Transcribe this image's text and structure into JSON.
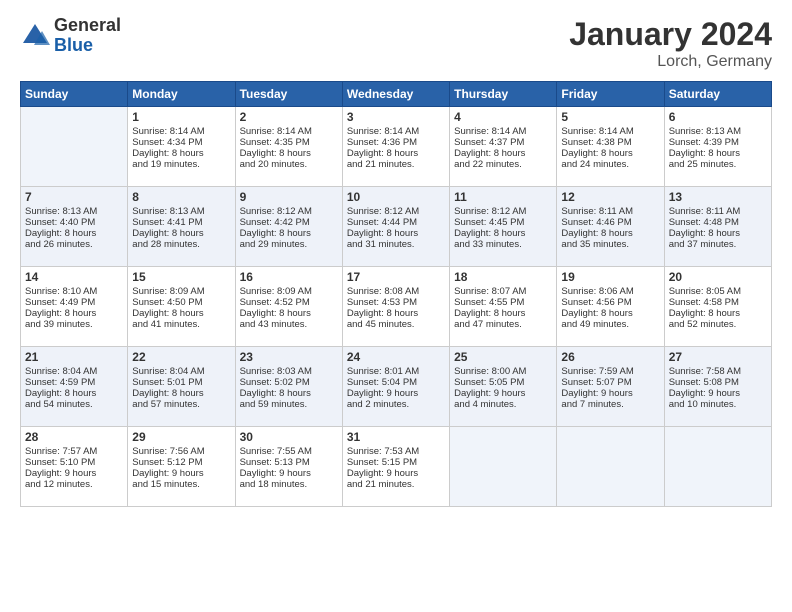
{
  "header": {
    "logo_general": "General",
    "logo_blue": "Blue",
    "title": "January 2024",
    "subtitle": "Lorch, Germany"
  },
  "days_of_week": [
    "Sunday",
    "Monday",
    "Tuesday",
    "Wednesday",
    "Thursday",
    "Friday",
    "Saturday"
  ],
  "weeks": [
    [
      {
        "day": "",
        "info": ""
      },
      {
        "day": "1",
        "info": "Sunrise: 8:14 AM\nSunset: 4:34 PM\nDaylight: 8 hours\nand 19 minutes."
      },
      {
        "day": "2",
        "info": "Sunrise: 8:14 AM\nSunset: 4:35 PM\nDaylight: 8 hours\nand 20 minutes."
      },
      {
        "day": "3",
        "info": "Sunrise: 8:14 AM\nSunset: 4:36 PM\nDaylight: 8 hours\nand 21 minutes."
      },
      {
        "day": "4",
        "info": "Sunrise: 8:14 AM\nSunset: 4:37 PM\nDaylight: 8 hours\nand 22 minutes."
      },
      {
        "day": "5",
        "info": "Sunrise: 8:14 AM\nSunset: 4:38 PM\nDaylight: 8 hours\nand 24 minutes."
      },
      {
        "day": "6",
        "info": "Sunrise: 8:13 AM\nSunset: 4:39 PM\nDaylight: 8 hours\nand 25 minutes."
      }
    ],
    [
      {
        "day": "7",
        "info": "Sunrise: 8:13 AM\nSunset: 4:40 PM\nDaylight: 8 hours\nand 26 minutes."
      },
      {
        "day": "8",
        "info": "Sunrise: 8:13 AM\nSunset: 4:41 PM\nDaylight: 8 hours\nand 28 minutes."
      },
      {
        "day": "9",
        "info": "Sunrise: 8:12 AM\nSunset: 4:42 PM\nDaylight: 8 hours\nand 29 minutes."
      },
      {
        "day": "10",
        "info": "Sunrise: 8:12 AM\nSunset: 4:44 PM\nDaylight: 8 hours\nand 31 minutes."
      },
      {
        "day": "11",
        "info": "Sunrise: 8:12 AM\nSunset: 4:45 PM\nDaylight: 8 hours\nand 33 minutes."
      },
      {
        "day": "12",
        "info": "Sunrise: 8:11 AM\nSunset: 4:46 PM\nDaylight: 8 hours\nand 35 minutes."
      },
      {
        "day": "13",
        "info": "Sunrise: 8:11 AM\nSunset: 4:48 PM\nDaylight: 8 hours\nand 37 minutes."
      }
    ],
    [
      {
        "day": "14",
        "info": "Sunrise: 8:10 AM\nSunset: 4:49 PM\nDaylight: 8 hours\nand 39 minutes."
      },
      {
        "day": "15",
        "info": "Sunrise: 8:09 AM\nSunset: 4:50 PM\nDaylight: 8 hours\nand 41 minutes."
      },
      {
        "day": "16",
        "info": "Sunrise: 8:09 AM\nSunset: 4:52 PM\nDaylight: 8 hours\nand 43 minutes."
      },
      {
        "day": "17",
        "info": "Sunrise: 8:08 AM\nSunset: 4:53 PM\nDaylight: 8 hours\nand 45 minutes."
      },
      {
        "day": "18",
        "info": "Sunrise: 8:07 AM\nSunset: 4:55 PM\nDaylight: 8 hours\nand 47 minutes."
      },
      {
        "day": "19",
        "info": "Sunrise: 8:06 AM\nSunset: 4:56 PM\nDaylight: 8 hours\nand 49 minutes."
      },
      {
        "day": "20",
        "info": "Sunrise: 8:05 AM\nSunset: 4:58 PM\nDaylight: 8 hours\nand 52 minutes."
      }
    ],
    [
      {
        "day": "21",
        "info": "Sunrise: 8:04 AM\nSunset: 4:59 PM\nDaylight: 8 hours\nand 54 minutes."
      },
      {
        "day": "22",
        "info": "Sunrise: 8:04 AM\nSunset: 5:01 PM\nDaylight: 8 hours\nand 57 minutes."
      },
      {
        "day": "23",
        "info": "Sunrise: 8:03 AM\nSunset: 5:02 PM\nDaylight: 8 hours\nand 59 minutes."
      },
      {
        "day": "24",
        "info": "Sunrise: 8:01 AM\nSunset: 5:04 PM\nDaylight: 9 hours\nand 2 minutes."
      },
      {
        "day": "25",
        "info": "Sunrise: 8:00 AM\nSunset: 5:05 PM\nDaylight: 9 hours\nand 4 minutes."
      },
      {
        "day": "26",
        "info": "Sunrise: 7:59 AM\nSunset: 5:07 PM\nDaylight: 9 hours\nand 7 minutes."
      },
      {
        "day": "27",
        "info": "Sunrise: 7:58 AM\nSunset: 5:08 PM\nDaylight: 9 hours\nand 10 minutes."
      }
    ],
    [
      {
        "day": "28",
        "info": "Sunrise: 7:57 AM\nSunset: 5:10 PM\nDaylight: 9 hours\nand 12 minutes."
      },
      {
        "day": "29",
        "info": "Sunrise: 7:56 AM\nSunset: 5:12 PM\nDaylight: 9 hours\nand 15 minutes."
      },
      {
        "day": "30",
        "info": "Sunrise: 7:55 AM\nSunset: 5:13 PM\nDaylight: 9 hours\nand 18 minutes."
      },
      {
        "day": "31",
        "info": "Sunrise: 7:53 AM\nSunset: 5:15 PM\nDaylight: 9 hours\nand 21 minutes."
      },
      {
        "day": "",
        "info": ""
      },
      {
        "day": "",
        "info": ""
      },
      {
        "day": "",
        "info": ""
      }
    ]
  ]
}
